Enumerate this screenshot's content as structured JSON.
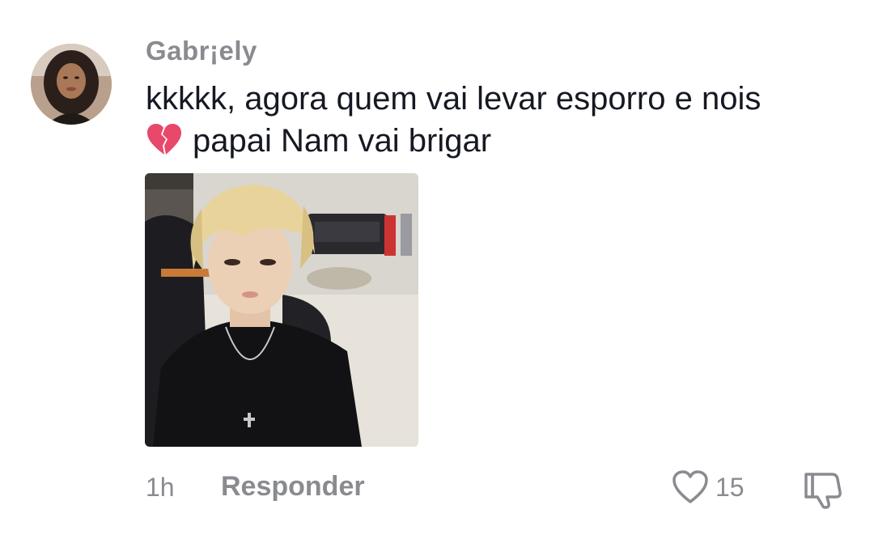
{
  "comment": {
    "username": "Gabr¡ely",
    "text_line1": "kkkkk, agora quem vai levar esporro e nois",
    "text_line2": "papai Nam vai brigar",
    "emoji": "broken-heart-icon",
    "time": "1h",
    "reply_label": "Responder",
    "likes": "15"
  },
  "colors": {
    "muted": "#8a8b91",
    "text": "#161823",
    "heart_emoji": "#e8486a"
  }
}
